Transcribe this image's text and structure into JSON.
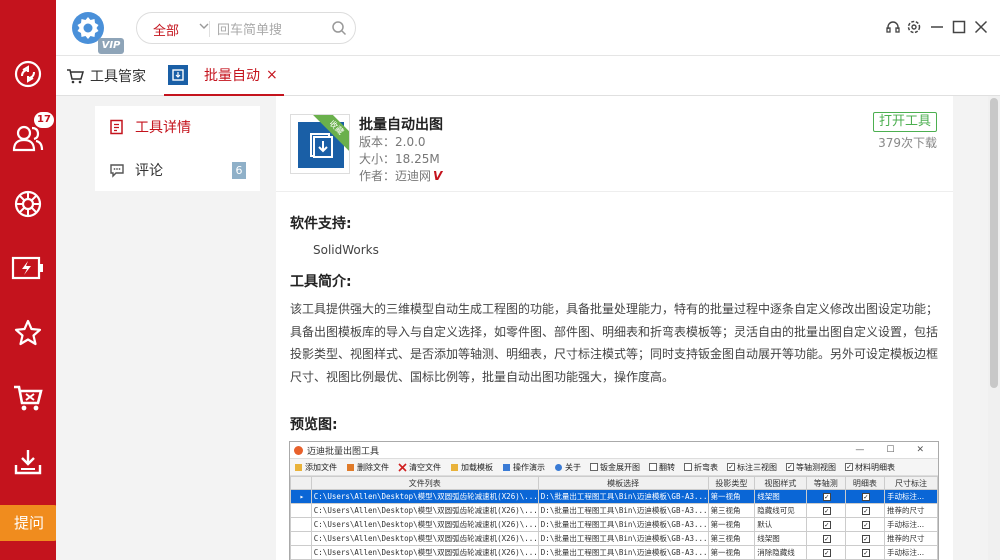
{
  "sidebar": {
    "items": [
      {
        "name": "recycle-icon"
      },
      {
        "name": "users-icon",
        "badge": "17"
      },
      {
        "name": "gear-wheel-icon"
      },
      {
        "name": "battery-icon"
      },
      {
        "name": "star-icon"
      },
      {
        "name": "cart-tools-icon"
      },
      {
        "name": "download-icon"
      }
    ],
    "ask_label": "提问"
  },
  "topbar": {
    "vip": "VIP",
    "search": {
      "scope": "全部",
      "placeholder": "回车简单搜"
    }
  },
  "tabs": {
    "manager": "工具管家",
    "active": "批量自动",
    "close": "×"
  },
  "leftnav": {
    "details": "工具详情",
    "comments": "评论",
    "comment_count": "6"
  },
  "tool": {
    "name": "批量自动出图",
    "version": "版本：2.0.0",
    "size": "大小：18.25M",
    "author": "作者：迈迪网",
    "author_mark": "V",
    "ribbon": "收藏",
    "open_button": "打开工具",
    "downloads": "379次下载"
  },
  "sections": {
    "support_title": "软件支持:",
    "support_value": "SolidWorks",
    "intro_title": "工具简介:",
    "intro_text": "该工具提供强大的三维模型自动生成工程图的功能，具备批量处理能力，特有的批量过程中逐条自定义修改出图设定功能；具备出图模板库的导入与自定义选择，如零件图、部件图、明细表和折弯表模板等；灵活自由的批量出图自定义设置，包括投影类型、视图样式、是否添加等轴测、明细表，尺寸标注模式等；同时支持钣金图自动展开等功能。另外可设定模板边框尺寸、视图比例最优、国标比例等，批量自动出图功能强大，操作度高。",
    "preview_title": "预览图:"
  },
  "preview": {
    "window_title": "迈迪批量出图工具",
    "toolbar": [
      "添加文件",
      "删除文件",
      "清空文件",
      "加载模板",
      "操作演示",
      "关于"
    ],
    "options": [
      "钣金展开图",
      "翻转",
      "折弯表",
      "标注三视图",
      "等轴测视图",
      "材料明细表"
    ],
    "options_checked": [
      false,
      false,
      false,
      true,
      true,
      true
    ],
    "columns": [
      "",
      "文件列表",
      "模板选择",
      "投影类型",
      "视图样式",
      "等轴测",
      "明细表",
      "尺寸标注"
    ],
    "rows": [
      {
        "file": "C:\\Users\\Allen\\Desktop\\模型\\双圆弧齿轮减速机(X26)\\...",
        "template": "D:\\批量出工程图工具\\Bin\\迈迪模板\\GB-A3...",
        "projection": "第一视角",
        "style": "线架图",
        "iso": "✓",
        "bom": "✓",
        "dim": "手动标注..."
      },
      {
        "file": "C:\\Users\\Allen\\Desktop\\模型\\双圆弧齿轮减速机(X26)\\...",
        "template": "D:\\批量出工程图工具\\Bin\\迈迪模板\\GB-A3...",
        "projection": "第三视角",
        "style": "隐藏线可见",
        "iso": "✓",
        "bom": "✓",
        "dim": "推荐的尺寸"
      },
      {
        "file": "C:\\Users\\Allen\\Desktop\\模型\\双圆弧齿轮减速机(X26)\\...",
        "template": "D:\\批量出工程图工具\\Bin\\迈迪模板\\GB-A3...",
        "projection": "第一视角",
        "style": "默认",
        "iso": "✓",
        "bom": "✓",
        "dim": "手动标注..."
      },
      {
        "file": "C:\\Users\\Allen\\Desktop\\模型\\双圆弧齿轮减速机(X26)\\...",
        "template": "D:\\批量出工程图工具\\Bin\\迈迪模板\\GB-A3...",
        "projection": "第三视角",
        "style": "线架图",
        "iso": "✓",
        "bom": "✓",
        "dim": "推荐的尺寸"
      },
      {
        "file": "C:\\Users\\Allen\\Desktop\\模型\\双圆弧齿轮减速机(X26)\\...",
        "template": "D:\\批量出工程图工具\\Bin\\迈迪模板\\GB-A3...",
        "projection": "第一视角",
        "style": "消除隐藏线",
        "iso": "✓",
        "bom": "✓",
        "dim": "手动标注..."
      }
    ]
  },
  "colors": {
    "brand_red": "#c4131d",
    "open_green": "#4caf50",
    "ask_orange": "#f08c1e",
    "tool_blue": "#1a5fa6"
  }
}
